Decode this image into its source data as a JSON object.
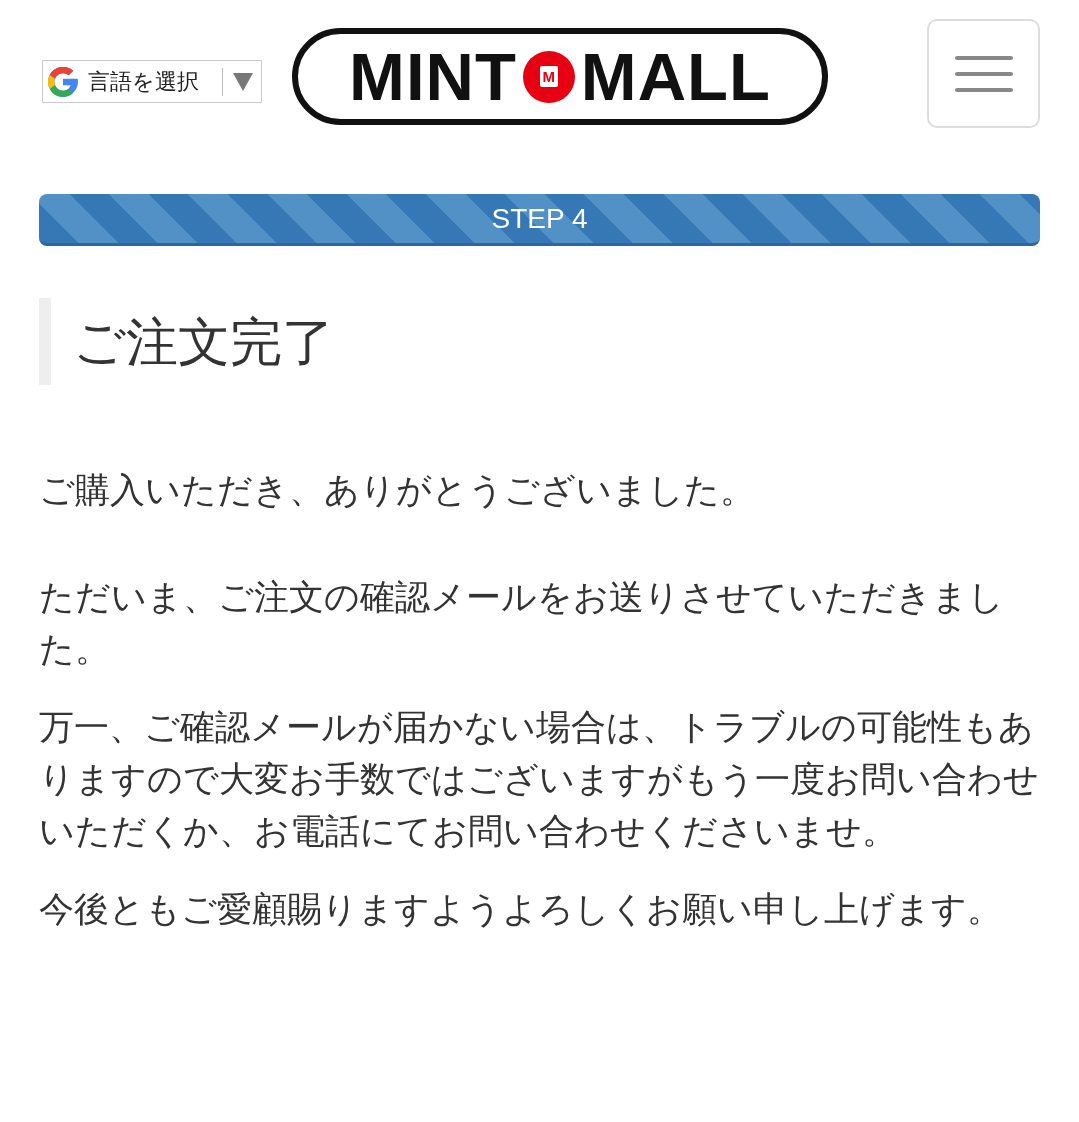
{
  "header": {
    "language_select": {
      "label": "言語を選択"
    },
    "logo": {
      "left": "MINT",
      "badge": "M",
      "right": "MALL"
    }
  },
  "step": {
    "label": "STEP 4"
  },
  "title": "ご注文完了",
  "paragraphs": [
    "ご購入いただき、ありがとうございました。",
    "ただいま、ご注文の確認メールをお送りさせていただきました。",
    "万一、ご確認メールが届かない場合は、トラブルの可能性もありますので大変お手数ではございますがもう一度お問い合わせいただくか、お電話にてお問い合わせくださいませ。",
    "今後ともご愛顧賜りますようよろしくお願い申し上げます。"
  ]
}
